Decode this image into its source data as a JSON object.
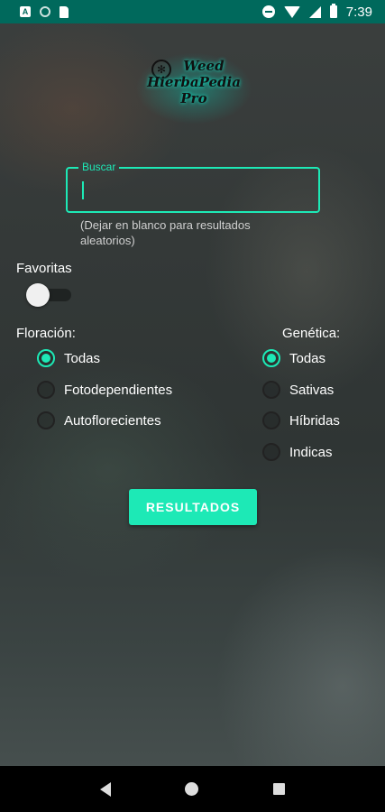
{
  "status_bar": {
    "time": "7:39",
    "left_icons": [
      "a-notification-icon",
      "circle-icon",
      "sd-card-icon"
    ],
    "right_icons": [
      "do-not-disturb-icon",
      "wifi-icon",
      "signal-icon",
      "battery-icon"
    ]
  },
  "logo": {
    "line1": "Weed",
    "line2": "HierbaPedia",
    "line3": "Pro",
    "icon": "cannabis-leaf-icon"
  },
  "search": {
    "label": "Buscar",
    "value": "",
    "hint": "(Dejar en blanco para resultados aleatorios)"
  },
  "favorites": {
    "label": "Favoritas",
    "enabled": false
  },
  "floracion": {
    "title": "Floración:",
    "options": [
      "Todas",
      "Fotodependientes",
      "Autoflorecientes"
    ],
    "selected": "Todas"
  },
  "genetica": {
    "title": "Genética:",
    "options": [
      "Todas",
      "Sativas",
      "Híbridas",
      "Indicas"
    ],
    "selected": "Todas"
  },
  "results_button": {
    "label": "RESULTADOS"
  },
  "colors": {
    "accent": "#1de9b6",
    "status_bar": "#00695c",
    "nav_bar": "#000000"
  },
  "nav_bar": {
    "icons": [
      "back-icon",
      "home-icon",
      "recents-icon"
    ]
  }
}
